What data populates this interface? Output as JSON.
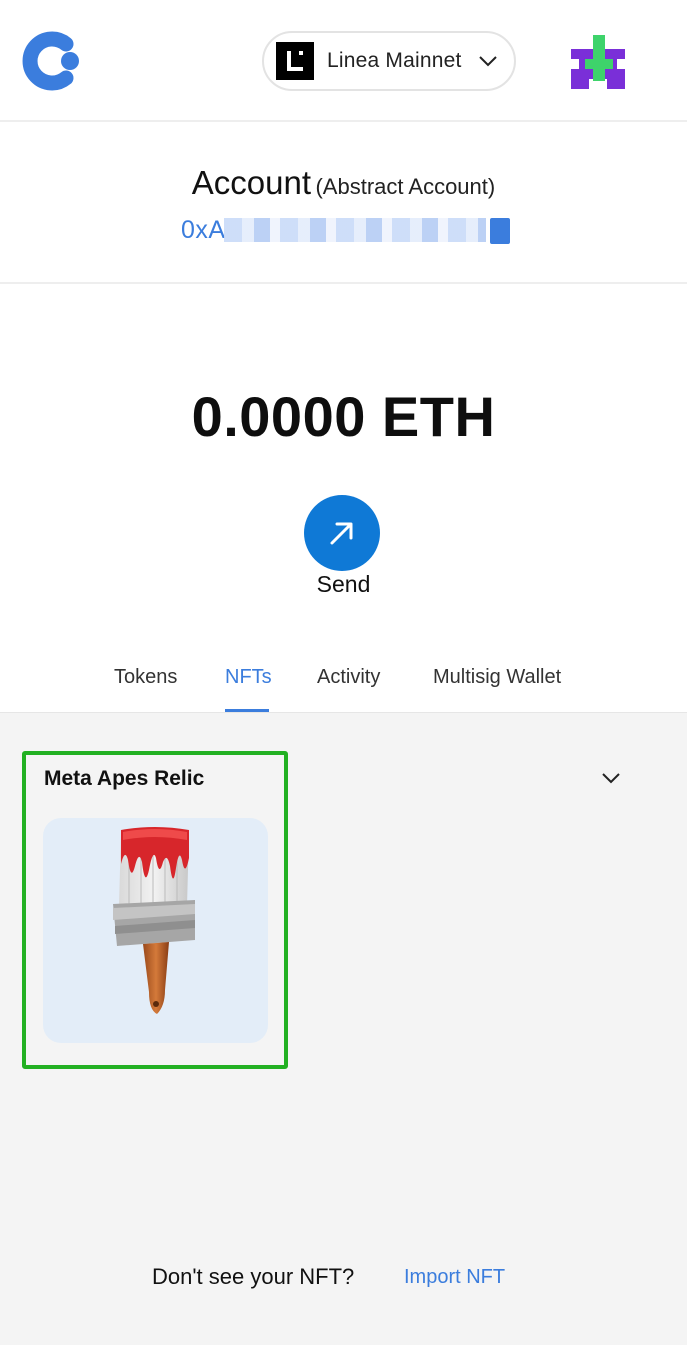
{
  "header": {
    "logo_icon": "app-logo-icon",
    "network": {
      "name": "Linea Mainnet",
      "icon": "linea-logo-icon"
    },
    "avatar_icon": "account-avatar-icon"
  },
  "account": {
    "title": "Account",
    "subtitle": "(Abstract Account)",
    "address_prefix": "0xA",
    "copy_icon": "copy-icon"
  },
  "balance": {
    "amount": "0.0000 ETH"
  },
  "actions": {
    "send_label": "Send"
  },
  "tabs": [
    {
      "label": "Tokens",
      "active": false
    },
    {
      "label": "NFTs",
      "active": true
    },
    {
      "label": "Activity",
      "active": false
    },
    {
      "label": "Multisig Wallet",
      "active": false
    }
  ],
  "nfts": {
    "collection_name": "Meta Apes Relic",
    "item_icon": "paintbrush-nft-image"
  },
  "footer": {
    "prompt": "Don't see your NFT?",
    "link": "Import NFT"
  },
  "colors": {
    "accent": "#3b7ddd",
    "send_button": "#0f79d6",
    "selection_border": "#22b022",
    "content_bg": "#f4f4f4"
  }
}
